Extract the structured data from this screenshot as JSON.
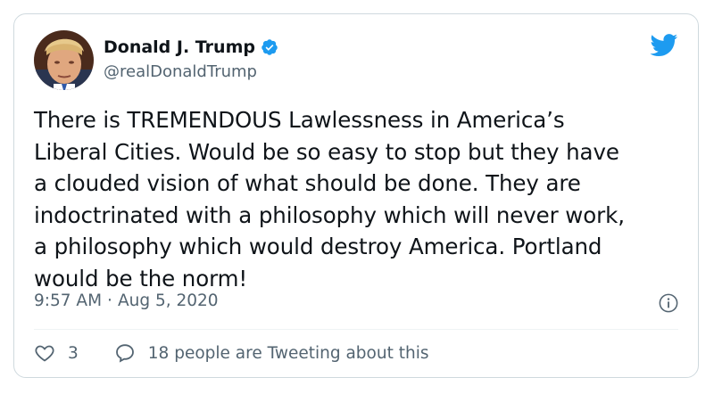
{
  "author": {
    "name": "Donald J. Trump",
    "handle": "@realDonaldTrump",
    "verified": true
  },
  "tweet": {
    "text": "There is TREMENDOUS Lawlessness in America’s\nLiberal Cities. Would be so easy to stop but they have\na clouded vision of what should be done. They are\nindoctrinated with a philosophy which will never work,\na philosophy which would destroy America. Portland\nwould be the norm!",
    "time": "9:57 AM",
    "separator": "·",
    "date": "Aug 5, 2020"
  },
  "actions": {
    "likes": "3",
    "tweeting_text": "18 people are Tweeting about this"
  },
  "icons": {
    "brand": "twitter-bird-icon",
    "verified": "verified-badge-icon",
    "info": "info-icon",
    "like": "heart-icon",
    "reply": "speech-bubble-icon"
  },
  "colors": {
    "brand": "#1d9bf0",
    "text": "#0f1419",
    "secondary": "#536471",
    "border": "#cfd9de"
  }
}
